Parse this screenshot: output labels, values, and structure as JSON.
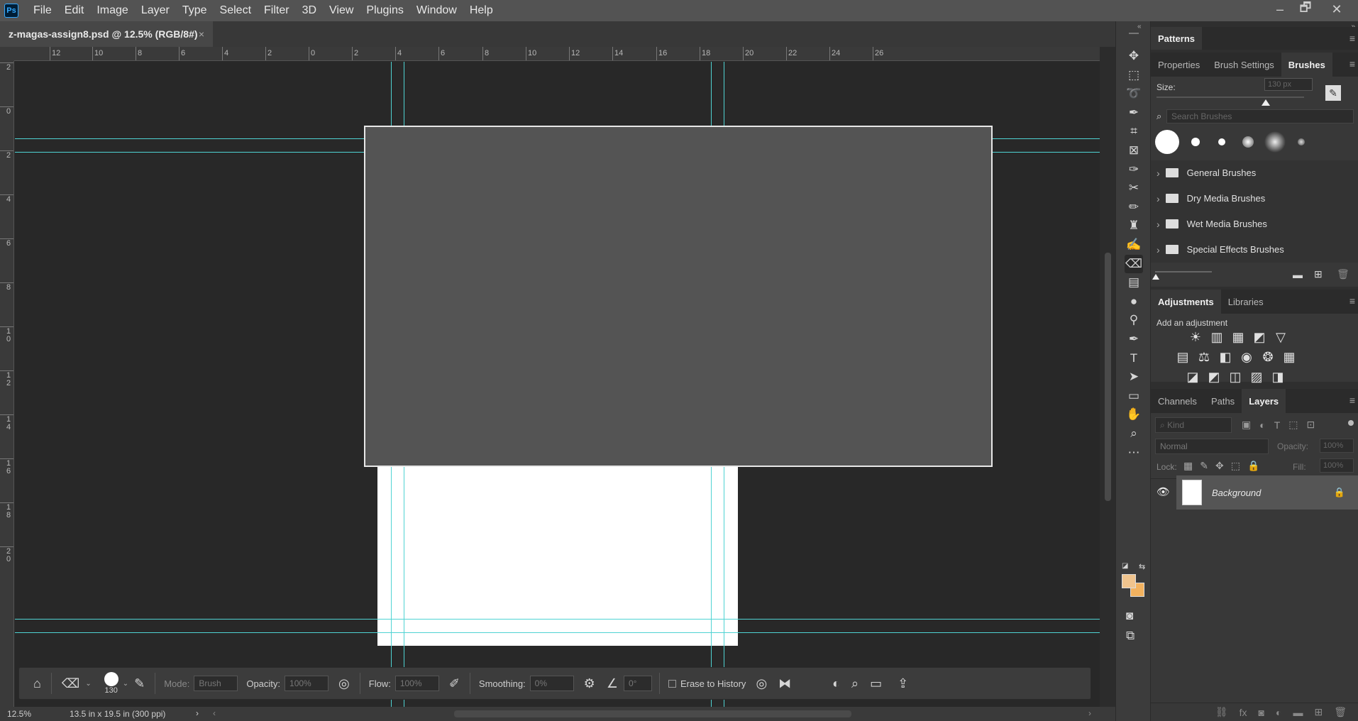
{
  "app": {
    "logo": "Ps"
  },
  "menu": [
    "File",
    "Edit",
    "Image",
    "Layer",
    "Type",
    "Select",
    "Filter",
    "3D",
    "View",
    "Plugins",
    "Window",
    "Help"
  ],
  "window_controls": {
    "minimize": "–",
    "restore": "🗗",
    "close": "✕"
  },
  "document_tab": {
    "title": "z-magas-assign8.psd @ 12.5% (RGB/8#)",
    "close": "×"
  },
  "ruler": {
    "h_labels": [
      "12",
      "10",
      "8",
      "6",
      "4",
      "2",
      "0",
      "2",
      "4",
      "6",
      "8",
      "10",
      "12",
      "14",
      "16",
      "18",
      "20",
      "22",
      "24",
      "26"
    ],
    "v_labels": [
      "2",
      "0",
      "2",
      "4",
      "6",
      "8",
      "1 0",
      "1 2",
      "1 4",
      "1 6",
      "1 8",
      "2 0"
    ]
  },
  "status": {
    "zoom": "12.5%",
    "doc_size": "13.5 in x 19.5 in (300 ppi)",
    "arrow": "›",
    "scroll_left": "‹",
    "scroll_right": "›"
  },
  "tools": [
    "move-icon",
    "marquee-icon",
    "lasso-icon",
    "quick-select-icon",
    "crop-icon",
    "frame-icon",
    "eyedropper-icon",
    "healing-icon",
    "brush-icon",
    "stamp-icon",
    "history-brush-icon",
    "eraser-icon",
    "gradient-icon",
    "blur-icon",
    "dodge-icon",
    "pen-icon",
    "type-icon",
    "path-select-icon",
    "rectangle-icon",
    "hand-icon",
    "zoom-icon",
    "more-icon"
  ],
  "colors": {
    "foreground": "#f0c48e",
    "background": "#f2b25f",
    "guide": "#4fd3d3",
    "canvas_bg": "#282828",
    "doc_white": "#ffffff",
    "overlay_gray": "#545454"
  },
  "patterns_panel": {
    "title": "Patterns"
  },
  "brushes_panel": {
    "tabs": [
      "Properties",
      "Brush Settings",
      "Brushes"
    ],
    "active_tab": "Brushes",
    "size_label": "Size:",
    "size_value": "130 px",
    "size_fraction": 0.74,
    "search_placeholder": "Search Brushes",
    "folders": [
      "General Brushes",
      "Dry Media Brushes",
      "Wet Media Brushes",
      "Special Effects Brushes"
    ]
  },
  "adjustments_panel": {
    "tabs": [
      "Adjustments",
      "Libraries"
    ],
    "active_tab": "Adjustments",
    "subtitle": "Add an adjustment",
    "row1": [
      "☀",
      "▥",
      "▦",
      "◩",
      "▽"
    ],
    "row2": [
      "▤",
      "⚖",
      "◧",
      "◉",
      "❂",
      "▦"
    ],
    "row3": [
      "◪",
      "◩",
      "◫",
      "▨",
      "◨"
    ]
  },
  "layers_panel": {
    "tabs": [
      "Channels",
      "Paths",
      "Layers"
    ],
    "active_tab": "Layers",
    "kind_placeholder": "Kind",
    "blend_mode": "Normal",
    "opacity_label": "Opacity:",
    "opacity_value": "100%",
    "lock_label": "Lock:",
    "fill_label": "Fill:",
    "fill_value": "100%",
    "layers": [
      {
        "name": "Background",
        "visible": true,
        "locked": true
      }
    ]
  },
  "options_bar": {
    "brush_size": "130",
    "mode_label": "Mode:",
    "mode_value": "Brush",
    "opacity_label": "Opacity:",
    "opacity_value": "100%",
    "flow_label": "Flow:",
    "flow_value": "100%",
    "smoothing_label": "Smoothing:",
    "smoothing_value": "0%",
    "angle_value": "0°",
    "erase_history_label": "Erase to History"
  }
}
